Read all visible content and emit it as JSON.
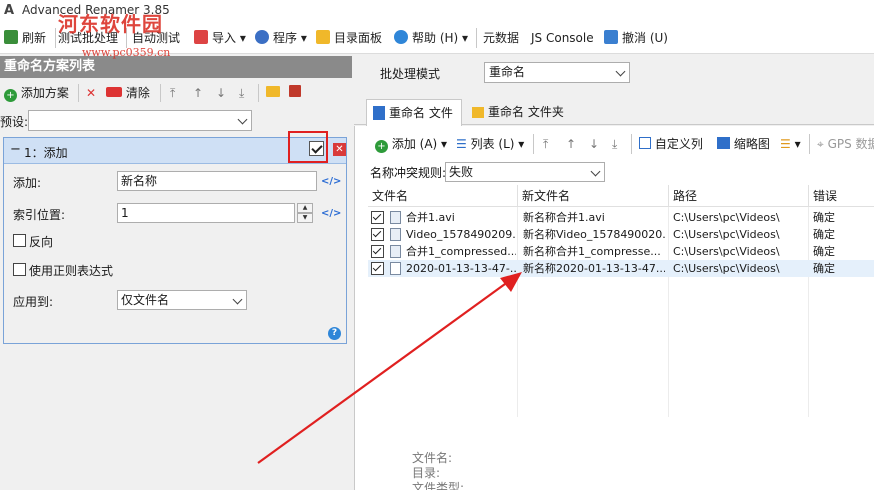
{
  "window": {
    "app_title": "Advanced Renamer 3.85"
  },
  "watermark": {
    "text": "河东软件园",
    "url": "www.pc0359.cn"
  },
  "toolbar": {
    "refresh": "刷新",
    "test_batch": "测试批处理",
    "auto_test": "自动测试",
    "import": "导入",
    "program": "程序",
    "folder_panel": "目录面板",
    "help": "帮助 (H)",
    "metadata": "元数据",
    "js_console": "JS Console",
    "undo": "撤消 (U)"
  },
  "left_panel": {
    "header": "重命名方案列表",
    "add_method": "添加方案",
    "clear": "清除",
    "preset_label": "预设:",
    "preset_value": ""
  },
  "method": {
    "title": "1：添加",
    "add_label": "添加:",
    "add_value": "新名称",
    "index_label": "索引位置:",
    "index_value": "1",
    "reverse_label": "反向",
    "regex_label": "使用正则表达式",
    "apply_label": "应用到:",
    "apply_value": "仅文件名"
  },
  "right_panel": {
    "batch_mode_label": "批处理模式",
    "batch_mode_value": "重命名",
    "tab_files": "重命名 文件",
    "tab_folders": "重命名 文件夹",
    "add": "添加 (A)",
    "list": "列表 (L)",
    "custom_columns": "自定义列",
    "thumbnails": "缩略图",
    "gps": "GPS 数据",
    "conflict_label": "名称冲突规则:",
    "conflict_value": "失败"
  },
  "grid": {
    "headers": [
      "文件名",
      "新文件名",
      "路径",
      "错误"
    ],
    "rows": [
      {
        "file": "合并1.avi",
        "new": "新名称合并1.avi",
        "path": "C:\\Users\\pc\\Videos\\",
        "error": "确定"
      },
      {
        "file": "Video_1578490209....",
        "new": "新名称Video_1578490020...",
        "path": "C:\\Users\\pc\\Videos\\",
        "error": "确定"
      },
      {
        "file": "合并1_compressed....",
        "new": "新名称合并1_compresse...",
        "path": "C:\\Users\\pc\\Videos\\",
        "error": "确定"
      },
      {
        "file": "2020-01-13-13-47-...",
        "new": "新名称2020-01-13-13-47...",
        "path": "C:\\Users\\pc\\Videos\\",
        "error": "确定"
      }
    ]
  },
  "info": {
    "filename": "文件名:",
    "directory": "目录:",
    "filetype": "文件类型:"
  }
}
